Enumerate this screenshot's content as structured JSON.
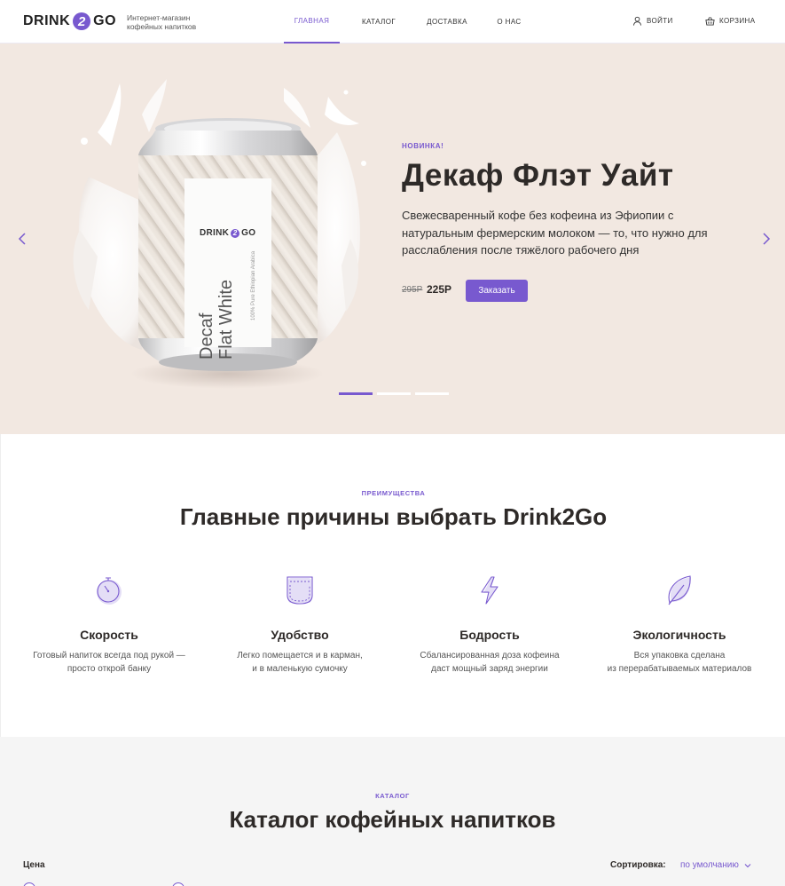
{
  "header": {
    "logo": {
      "left": "DRINK",
      "mid": "2",
      "right": "GO"
    },
    "tagline": "Интернет-магазин кофейных напитков",
    "nav": [
      {
        "label": "ГЛАВНАЯ",
        "active": true
      },
      {
        "label": "КАТАЛОГ",
        "active": false
      },
      {
        "label": "ДОСТАВКА",
        "active": false
      },
      {
        "label": "О НАС",
        "active": false
      }
    ],
    "login": "ВОЙТИ",
    "cart": "КОРЗИНА"
  },
  "hero": {
    "can": {
      "brand": {
        "left": "DRINK",
        "mid": "2",
        "right": "GO"
      },
      "name_line1": "Decaf",
      "name_line2": "Flat White",
      "subtitle": "100% Pure Ethiopian Arabica"
    },
    "tag": "НОВИНКА!",
    "title": "Декаф Флэт Уайт",
    "description": "Свежесваренный кофе без кофеина из Эфиопии с натуральным фермерским молоком — то, что нужно для расслабления после тяжёлого рабочего дня",
    "old_price": "295Р",
    "price": "225Р",
    "order_button": "Заказать",
    "slides_total": 3,
    "slide_active": 1
  },
  "advantages": {
    "tag": "ПРЕИМУЩЕСТВА",
    "title": "Главные причины выбрать Drink2Go",
    "items": [
      {
        "icon": "stopwatch-icon",
        "title": "Скорость",
        "text_line1": "Готовый напиток всегда под рукой —",
        "text_line2": "просто открой банку"
      },
      {
        "icon": "pocket-icon",
        "title": "Удобство",
        "text_line1": "Легко помещается и в карман,",
        "text_line2": "и в маленькую сумочку"
      },
      {
        "icon": "lightning-icon",
        "title": "Бодрость",
        "text_line1": "Сбалансированная доза кофеина",
        "text_line2": "даст мощный заряд энергии"
      },
      {
        "icon": "leaf-icon",
        "title": "Экологичность",
        "text_line1": "Вся упаковка сделана",
        "text_line2": "из перерабатываемых материалов"
      }
    ]
  },
  "catalog": {
    "tag": "КАТАЛОГ",
    "title": "Каталог кофейных напитков",
    "price_label": "Цена",
    "sort_label": "Сортировка:",
    "sort_value": "по умолчанию"
  },
  "colors": {
    "accent": "#7859cf",
    "hero_bg": "#f2e8e1",
    "text_dark": "#2e2a28",
    "catalog_bg": "#f5f5f5"
  }
}
